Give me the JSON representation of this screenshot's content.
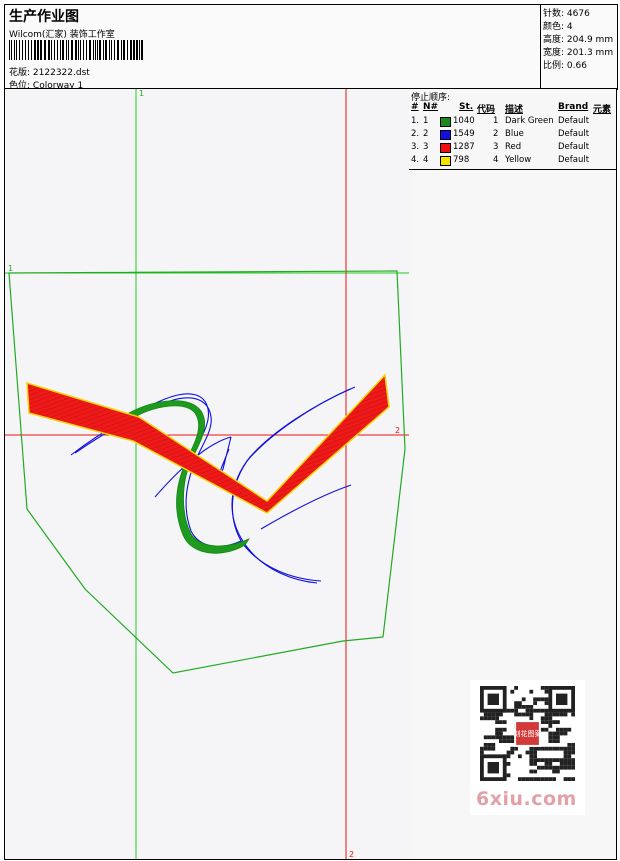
{
  "header": {
    "title": "生产作业图",
    "company": "Wilcom(汇家) 装饰工作室",
    "design_label": "花版:",
    "design_value": "2122322.dst",
    "colorway_label": "色位:",
    "colorway_value": "Colorway 1"
  },
  "stats": [
    {
      "label": "针数:",
      "value": "4676"
    },
    {
      "label": "颜色:",
      "value": "4"
    },
    {
      "label": "高度:",
      "value": "204.9 mm"
    },
    {
      "label": "宽度:",
      "value": "201.3 mm"
    },
    {
      "label": "比例:",
      "value": "0.66"
    }
  ],
  "guides": {
    "vertical_1": "1",
    "horizontal_1": "1",
    "horizontal_2": "2",
    "vertical_2": "2"
  },
  "stop_sequence": {
    "title": "停止顺序:",
    "headers": [
      "#",
      "N#",
      "St.",
      "代码",
      "描述",
      "Brand",
      "元素"
    ],
    "rows": [
      {
        "num": "1.",
        "n": "1",
        "color": "#1a8a1a",
        "stitches": "1040",
        "code": "1",
        "desc": "Dark Green",
        "brand": "Default"
      },
      {
        "num": "2.",
        "n": "2",
        "color": "#1010e0",
        "stitches": "1549",
        "code": "2",
        "desc": "Blue",
        "brand": "Default"
      },
      {
        "num": "3.",
        "n": "3",
        "color": "#ee1111",
        "stitches": "1287",
        "code": "3",
        "desc": "Red",
        "brand": "Default"
      },
      {
        "num": "4.",
        "n": "4",
        "color": "#f2e400",
        "stitches": "798",
        "code": "4",
        "desc": "Yellow",
        "brand": "Default"
      }
    ]
  },
  "watermark": {
    "text": "6xiu.com",
    "seal": "刻花图案"
  },
  "colors": {
    "guide_green": "#22cc22",
    "guide_red": "#ee1111",
    "outline_green": "#22aa22"
  }
}
